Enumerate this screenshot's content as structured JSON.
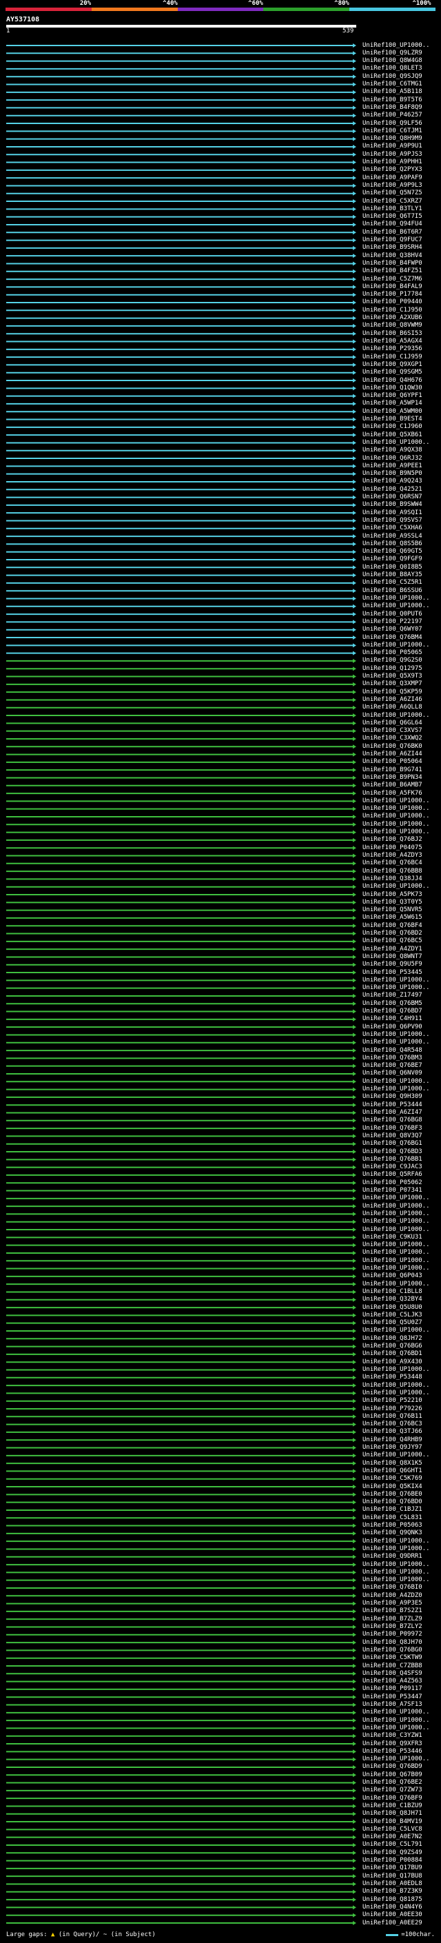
{
  "legend": {
    "thresholds": [
      "20%",
      "^40%",
      "^60%",
      "^80%",
      "^100%"
    ],
    "band_colors": [
      "#d8233a",
      "#f0781e",
      "#7f2bbf",
      "#2ca02c",
      "#48c6e0"
    ]
  },
  "query": {
    "name": "AY537108",
    "start": "1",
    "end": "539"
  },
  "hit_colors": {
    "identity_80_100": "#55d1e6",
    "identity_60_80": "#3fbf3f"
  },
  "hits": [
    "UniRef100_UP1000..",
    "UniRef100_Q9LZR9",
    "UniRef100_Q8W4G8",
    "UniRef100_Q8LET3",
    "UniRef100_Q9SJQ9",
    "UniRef100_C6TMG1",
    "UniRef100_A5B118",
    "UniRef100_B9T5T6",
    "UniRef100_B4F8Q9",
    "UniRef100_P46257",
    "UniRef100_Q9LF56",
    "UniRef100_C6TJM1",
    "UniRef100_Q8H9M9",
    "UniRef100_A9P9U1",
    "UniRef100_A9PJS3",
    "UniRef100_A9PHH1",
    "UniRef100_Q2PYX3",
    "UniRef100_A9PAF9",
    "UniRef100_A9P9L3",
    "UniRef100_Q5N7Z5",
    "UniRef100_C5XRZ7",
    "UniRef100_B3TLY1",
    "UniRef100_Q6T7I5",
    "UniRef100_Q94FU4",
    "UniRef100_B6T6R7",
    "UniRef100_Q9FUC7",
    "UniRef100_B9SRH4",
    "UniRef100_Q38HV4",
    "UniRef100_B4FWP0",
    "UniRef100_B4FZ51",
    "UniRef100_C5Z7M6",
    "UniRef100_B4FAL9",
    "UniRef100_P17784",
    "UniRef100_P09440",
    "UniRef100_C1J950",
    "UniRef100_A2XUB6",
    "UniRef100_Q8VWM9",
    "UniRef100_B6SI53",
    "UniRef100_A5AGX4",
    "UniRef100_P29356",
    "UniRef100_C1J959",
    "UniRef100_Q9XGP1",
    "UniRef100_Q9SGM5",
    "UniRef100_Q4H676",
    "UniRef100_Q1QW30",
    "UniRef100_Q6YPF1",
    "UniRef100_A5WP14",
    "UniRef100_A5WM00",
    "UniRef100_B9EST4",
    "UniRef100_C1J960",
    "UniRef100_Q5XB61",
    "UniRef100_UP1000..",
    "UniRef100_A9QX38",
    "UniRef100_Q6RJ32",
    "UniRef100_A9PEE1",
    "UniRef100_B9N5P0",
    "UniRef100_A9Q243",
    "UniRef100_Q42521",
    "UniRef100_Q6RSN7",
    "UniRef100_B9SWW4",
    "UniRef100_A9SQI1",
    "UniRef100_Q9SVS7",
    "UniRef100_C5XHA6",
    "UniRef100_A9SSL4",
    "UniRef100_Q8S5B6",
    "UniRef100_Q69GT5",
    "UniRef100_Q9FGF9",
    "UniRef100_Q0I8B5",
    "UniRef100_B8AY35",
    "UniRef100_C5Z5R1",
    "UniRef100_B6SSU6",
    "UniRef100_UP1000..",
    "UniRef100_UP1000..",
    "UniRef100_Q0PUT6",
    "UniRef100_P22197",
    "UniRef100_Q6WY07",
    "UniRef100_Q76BM4",
    "UniRef100_UP1000..",
    "UniRef100_P05065",
    "UniRef100_Q9G2S0",
    "UniRef100_Q12975",
    "UniRef100_Q5X9T3",
    "UniRef100_Q3XMP7",
    "UniRef100_Q5KP59",
    "UniRef100_A6ZI46",
    "UniRef100_A6QLL8",
    "UniRef100_UP1000..",
    "UniRef100_Q6GL64",
    "UniRef100_C3XVS7",
    "UniRef100_C3XWQ2",
    "UniRef100_Q76BK0",
    "UniRef100_A6ZI44",
    "UniRef100_P05064",
    "UniRef100_B9G741",
    "UniRef100_B9PN34",
    "UniRef100_B6AMB7",
    "UniRef100_A5FK76",
    "UniRef100_UP1000..",
    "UniRef100_UP1000..",
    "UniRef100_UP1000..",
    "UniRef100_UP1000..",
    "UniRef100_UP1000..",
    "UniRef100_Q76BJ2",
    "UniRef100_P04075",
    "UniRef100_A4ZDY3",
    "UniRef100_Q76BC4",
    "UniRef100_Q76BB8",
    "UniRef100_Q38JJ4",
    "UniRef100_UP1000..",
    "UniRef100_A5PK73",
    "UniRef100_Q3T0Y5",
    "UniRef100_Q5NVR5",
    "UniRef100_A5W615",
    "UniRef100_Q76BF4",
    "UniRef100_Q76BD2",
    "UniRef100_Q76BC5",
    "UniRef100_A4ZDY1",
    "UniRef100_Q8WNT7",
    "UniRef100_Q9U5F9",
    "UniRef100_P53445",
    "UniRef100_UP1000..",
    "UniRef100_UP1000..",
    "UniRef100_Z17497",
    "UniRef100_Q76BM5",
    "UniRef100_Q76BD7",
    "UniRef100_C4H911",
    "UniRef100_Q6PV90",
    "UniRef100_UP1000..",
    "UniRef100_UP1000..",
    "UniRef100_Q4R548",
    "UniRef100_Q76BM3",
    "UniRef100_Q76BE7",
    "UniRef100_Q6NV09",
    "UniRef100_UP1000..",
    "UniRef100_UP1000..",
    "UniRef100_Q9H309",
    "UniRef100_P53444",
    "UniRef100_A6ZI47",
    "UniRef100_Q76BG8",
    "UniRef100_Q76BF3",
    "UniRef100_Q8V3Q7",
    "UniRef100_Q76BG1",
    "UniRef100_Q76BD3",
    "UniRef100_Q76BB1",
    "UniRef100_C9JAC3",
    "UniRef100_Q5RFA6",
    "UniRef100_P05062",
    "UniRef100_P07341",
    "UniRef100_UP1000..",
    "UniRef100_UP1000..",
    "UniRef100_UP1000..",
    "UniRef100_UP1000..",
    "UniRef100_UP1000..",
    "UniRef100_C9KU31",
    "UniRef100_UP1000..",
    "UniRef100_UP1000..",
    "UniRef100_UP1000..",
    "UniRef100_UP1000..",
    "UniRef100_Q6P043",
    "UniRef100_UP1000..",
    "UniRef100_C1BLL8",
    "UniRef100_Q32BY4",
    "UniRef100_Q5U8U0",
    "UniRef100_C5LJK3",
    "UniRef100_Q5U0Z7",
    "UniRef100_UP1000..",
    "UniRef100_Q8JH72",
    "UniRef100_Q76BG6",
    "UniRef100_Q76BD1",
    "UniRef100_A9X430",
    "UniRef100_UP1000..",
    "UniRef100_P53448",
    "UniRef100_UP1000..",
    "UniRef100_UP1000..",
    "UniRef100_P52210",
    "UniRef100_P79226",
    "UniRef100_Q76B11",
    "UniRef100_Q76BC3",
    "UniRef100_Q3TJ66",
    "UniRef100_Q4RHB9",
    "UniRef100_Q9JY97",
    "UniRef100_UP1000..",
    "UniRef100_Q8X1K5",
    "UniRef100_Q6GHT1",
    "UniRef100_C5K769",
    "UniRef100_Q5KIX4",
    "UniRef100_Q76BE0",
    "UniRef100_Q76BD0",
    "UniRef100_C1BJZ1",
    "UniRef100_C5L831",
    "UniRef100_P05063",
    "UniRef100_Q9QNK3",
    "UniRef100_UP1000..",
    "UniRef100_UP1000..",
    "UniRef100_Q9DRR1",
    "UniRef100_UP1000..",
    "UniRef100_UP1000..",
    "UniRef100_UP1000..",
    "UniRef100_Q76BI0",
    "UniRef100_A4ZDZ0",
    "UniRef100_A9P3E5",
    "UniRef100_B7S2Z1",
    "UniRef100_B7ZLZ9",
    "UniRef100_B7ZLY2",
    "UniRef100_P09972",
    "UniRef100_Q8JH70",
    "UniRef100_Q76BG0",
    "UniRef100_C5KTW9",
    "UniRef100_C7ZBB8",
    "UniRef100_Q4SFS9",
    "UniRef100_A4Z563",
    "UniRef100_P09117",
    "UniRef100_P53447",
    "UniRef100_A7SF13",
    "UniRef100_UP1000..",
    "UniRef100_UP1000..",
    "UniRef100_UP1000..",
    "UniRef100_C3YZW1",
    "UniRef100_Q9XFR3",
    "UniRef100_P53446",
    "UniRef100_UP1000..",
    "UniRef100_Q76BD9",
    "UniRef100_Q67B09",
    "UniRef100_Q76BE2",
    "UniRef100_Q7ZW73",
    "UniRef100_Q76BF9",
    "UniRef100_C1BZU9",
    "UniRef100_Q8JH71",
    "UniRef100_B4MV19",
    "UniRef100_C5LVC8",
    "UniRef100_A0E7N2",
    "UniRef100_C5L791",
    "UniRef100_Q9ZS49",
    "UniRef100_P00884",
    "UniRef100_Q17BU9",
    "UniRef100_Q17BU8",
    "UniRef100_A0EDL8",
    "UniRef100_B7Z3K9",
    "UniRef100_Q81875",
    "UniRef100_Q4N4Y6",
    "UniRef100_A0EE30",
    "UniRef100_A0EE29"
  ],
  "footer": {
    "large_gaps_text": "Large gaps:",
    "in_query_text": "(in Query)/",
    "in_subject_glyph": "~",
    "in_subject_text": "(in Subject)",
    "scale_text": "=100char."
  }
}
